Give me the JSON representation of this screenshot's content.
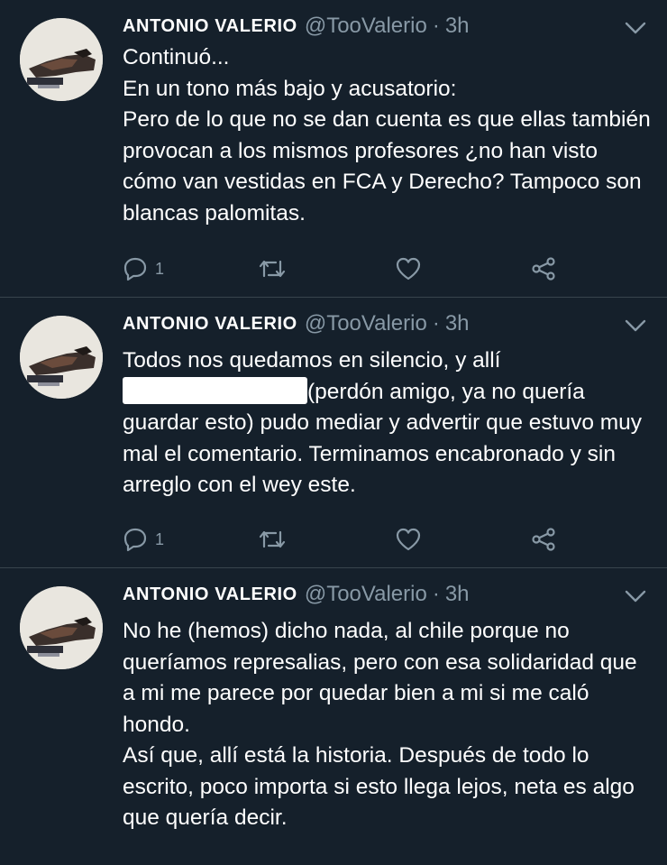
{
  "tweets": [
    {
      "author_name": "ANTONIO VALERIO",
      "handle": "@TooValerio",
      "separator": "·",
      "time": "3h",
      "lines": [
        "Continuó...",
        "En un tono más bajo y acusatorio:",
        "Pero de lo que no se dan cuenta es que ellas también provocan a los mismos profesores ¿no han visto cómo van vestidas en FCA y Derecho? Tampoco son blancas palomitas."
      ],
      "reply_count": "1"
    },
    {
      "author_name": "ANTONIO VALERIO",
      "handle": "@TooValerio",
      "separator": "·",
      "time": "3h",
      "text_before": "Todos nos quedamos en silencio, y allí",
      "text_after": "(perdón amigo, ya no quería guardar esto) pudo mediar y advertir que estuvo muy mal el comentario. Terminamos encabronado y sin arreglo con el wey este.",
      "reply_count": "1"
    },
    {
      "author_name": "ANTONIO VALERIO",
      "handle": "@TooValerio",
      "separator": "·",
      "time": "3h",
      "lines": [
        "No he (hemos) dicho nada, al chile porque no queríamos represalias, pero con esa solidaridad que a mi me parece por quedar bien a mi si me caló hondo.",
        "Así que, allí está la historia. Después de todo lo escrito, poco importa si esto llega lejos, neta es algo que quería decir."
      ]
    }
  ],
  "icons": {
    "reply": "reply-icon",
    "retweet": "retweet-icon",
    "like": "heart-icon",
    "share": "share-icon",
    "more": "chevron-down-icon"
  },
  "colors": {
    "background": "#15202b",
    "secondary_text": "#8899a6",
    "divider": "#38444d",
    "redaction": "#ffffff"
  }
}
